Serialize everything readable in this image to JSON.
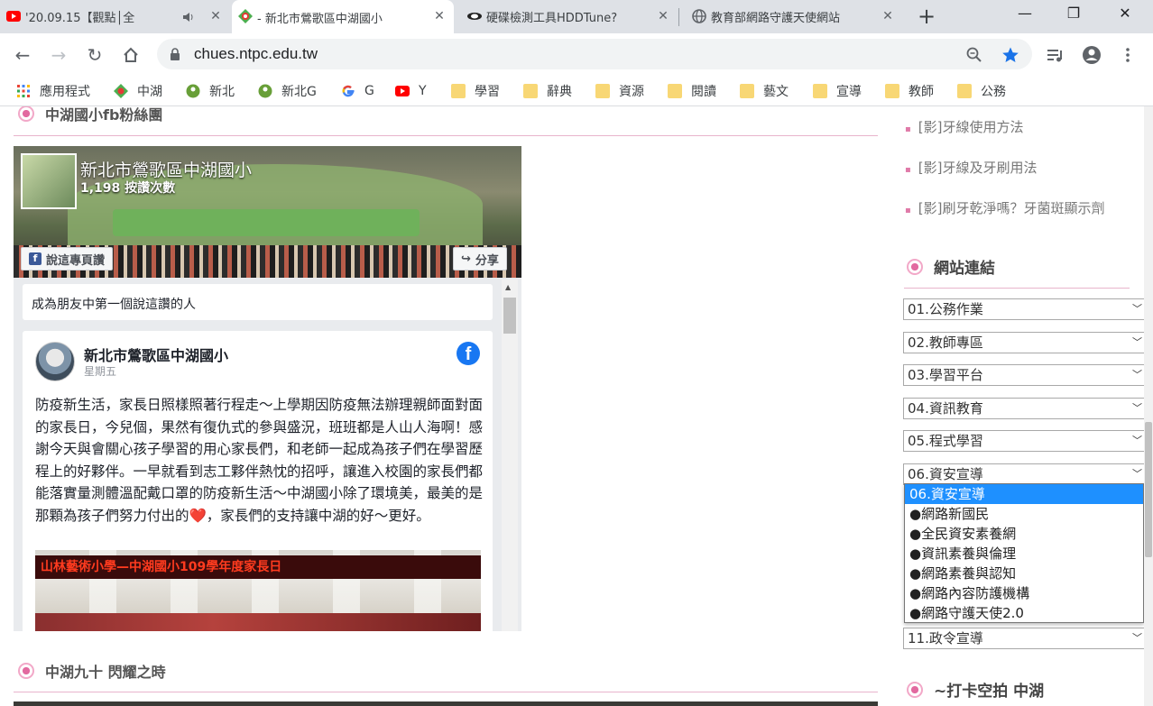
{
  "browser": {
    "tabs": [
      {
        "title": "'20.09.15【觀點│全",
        "favicon": "youtube-icon",
        "audio": true
      },
      {
        "title": "- 新北市鶯歌區中湖國小",
        "favicon": "school-icon",
        "active": true
      },
      {
        "title": "硬碟檢測工具HDDTune?",
        "favicon": "eye-icon"
      },
      {
        "title": "教育部網路守護天使網站",
        "favicon": "globe-icon"
      }
    ],
    "url": "chues.ntpc.edu.tw",
    "bookmarks": [
      {
        "label": "應用程式",
        "icon": "apps-grid-icon"
      },
      {
        "label": "中湖",
        "icon": "school-icon"
      },
      {
        "label": "新北",
        "icon": "green-circle-icon"
      },
      {
        "label": "新北G",
        "icon": "green-circle-icon"
      },
      {
        "label": "G",
        "icon": "google-icon"
      },
      {
        "label": "Y",
        "icon": "youtube-icon"
      },
      {
        "label": "學習",
        "icon": "folder-icon"
      },
      {
        "label": "辭典",
        "icon": "folder-icon"
      },
      {
        "label": "資源",
        "icon": "folder-icon"
      },
      {
        "label": "閱讀",
        "icon": "folder-icon"
      },
      {
        "label": "藝文",
        "icon": "folder-icon"
      },
      {
        "label": "宣導",
        "icon": "folder-icon"
      },
      {
        "label": "教師",
        "icon": "folder-icon"
      },
      {
        "label": "公務",
        "icon": "folder-icon"
      }
    ]
  },
  "main": {
    "top_section_title": "中湖國小fb粉絲團",
    "bottom_section_title": "中湖九十 閃耀之時",
    "fb_page": {
      "name": "新北市鶯歌區中湖國小",
      "likes": "1,198 按讚次數",
      "like_button": "說這專頁讚",
      "share_button": "分享",
      "friends_text": "成為朋友中第一個說這讚的人",
      "post": {
        "author": "新北市鶯歌區中湖國小",
        "date": "星期五",
        "text": "防疫新生活，家長日照樣照著行程走～上學期因防疫無法辦理親師面對面的家長日，今兒個，果然有復仇式的參與盛況，班班都是人山人海啊！感謝今天與會關心孩子學習的用心家長們，和老師一起成為孩子們在學習歷程上的好夥伴。一早就看到志工夥伴熱忱的招呼，讓進入校園的家長們都能落實量測體溫配戴口罩的防疫新生活～中湖國小除了環境美，最美的是那顆為孩子們努力付出的❤️，家長們的支持讓中湖的好～更好。",
        "image_sign": "山林藝術小學—中湖國小109學年度家長日"
      }
    }
  },
  "sidebar": {
    "links": [
      "[影]牙線使用方法",
      "[影]牙線及牙刷用法",
      "[影]刷牙乾淨嗎？牙菌斑顯示劑"
    ],
    "links_heading": "網站連結",
    "selects": [
      "01.公務作業",
      "02.教師專區",
      "03.學習平台",
      "04.資訊教育",
      "05.程式學習",
      "06.資安宣導"
    ],
    "last_select": "11.政令宣導",
    "dropdown_options": [
      "06.資安宣導",
      "●網路新國民",
      "●全民資安素養網",
      "●資訊素養與倫理",
      "●網路素養與認知",
      "●網路內容防護機構",
      "●網路守護天使2.0"
    ],
    "bottom_heading": "~打卡空拍 中湖"
  },
  "colors": {
    "accent_pink": "#e07aa8",
    "select_highlight": "#1e90ff",
    "facebook_blue": "#1877f2"
  }
}
